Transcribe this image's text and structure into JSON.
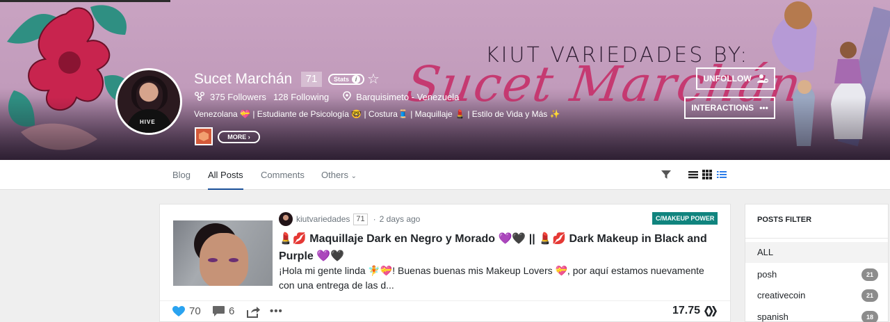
{
  "cover": {
    "title": "KIUT VARIEDADES BY:",
    "script_name": "Sucet Marchán",
    "colors": {
      "bg": "#c9a3c2",
      "accent": "#c6356e"
    }
  },
  "profile": {
    "name": "Sucet Marchán",
    "reputation": "71",
    "stats_label": "Stats",
    "followers": "375 Followers",
    "following": "128 Following",
    "location": "Barquisimeto - Venezuela",
    "bio": "Venezolana 💝 | Estudiante de Psicología 🤓 | Costura🧵 | Maquillaje 💄 | Estilo de Vida y Más ✨",
    "more_label": "MORE",
    "icons": [
      "followers-icon",
      "location-icon",
      "star-icon",
      "info-icon"
    ]
  },
  "actions": {
    "unfollow_label": "UNFOLLOW",
    "interactions_label": "INTERACTIONS"
  },
  "nav": {
    "tabs": [
      {
        "label": "Blog",
        "active": false
      },
      {
        "label": "All Posts",
        "active": true
      },
      {
        "label": "Comments",
        "active": false
      },
      {
        "label": "Others",
        "active": false
      }
    ],
    "icons": [
      "filter-icon",
      "list-view-icon",
      "grid-view-icon",
      "compact-view-icon"
    ]
  },
  "post": {
    "author": "kiutvariedades",
    "author_rep": "71",
    "time": "2 days ago",
    "community": "C/MAKEUP POWER",
    "title": "💄💋 Maquillaje Dark en Negro y Morado 💜🖤 || 💄💋 Dark Makeup in Black and Purple 💜🖤",
    "excerpt": "¡Hola mi gente linda 🧚💝! Buenas buenas mis Makeup Lovers 💝, por aquí estamos nuevamente con una entrega de las d...",
    "votes": "70",
    "comments": "6",
    "payout": "17.75"
  },
  "sidebar": {
    "title": "POSTS FILTER",
    "items": [
      {
        "label": "ALL",
        "count": ""
      },
      {
        "label": "posh",
        "count": "21"
      },
      {
        "label": "creativecoin",
        "count": "21"
      },
      {
        "label": "spanish",
        "count": "18"
      }
    ]
  }
}
